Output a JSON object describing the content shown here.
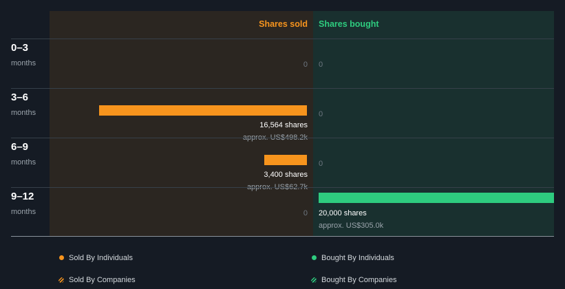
{
  "colors": {
    "sold": "#f7941d",
    "bought": "#2ecc7f",
    "sold_bg": "#2b2621",
    "bought_bg": "#19302f",
    "background": "#151b24"
  },
  "chart_data": {
    "type": "bar",
    "orientation": "horizontal-diverging",
    "columns": {
      "sold": "Shares sold",
      "bought": "Shares bought"
    },
    "rows": [
      {
        "period": "0–3",
        "unit": "months",
        "sold": 0,
        "sold_label": "0",
        "sold_approx": "",
        "bought": 0,
        "bought_label": "0",
        "bought_approx": ""
      },
      {
        "period": "3–6",
        "unit": "months",
        "sold": 16564,
        "sold_label": "16,564 shares",
        "sold_approx": "approx. US$498.2k",
        "bought": 0,
        "bought_label": "0",
        "bought_approx": ""
      },
      {
        "period": "6–9",
        "unit": "months",
        "sold": 3400,
        "sold_label": "3,400 shares",
        "sold_approx": "approx. US$62.7k",
        "bought": 0,
        "bought_label": "0",
        "bought_approx": ""
      },
      {
        "period": "9–12",
        "unit": "months",
        "sold": 0,
        "sold_label": "0",
        "sold_approx": "",
        "bought": 20000,
        "bought_label": "20,000 shares",
        "bought_approx": "approx. US$305.0k"
      }
    ],
    "legend": [
      {
        "label": "Sold By Individuals",
        "color": "#f7941d",
        "style": "solid"
      },
      {
        "label": "Bought By Individuals",
        "color": "#2ecc7f",
        "style": "solid"
      },
      {
        "label": "Sold By Companies",
        "color": "#f7941d",
        "style": "hatched"
      },
      {
        "label": "Bought By Companies",
        "color": "#2ecc7f",
        "style": "hatched"
      }
    ]
  }
}
